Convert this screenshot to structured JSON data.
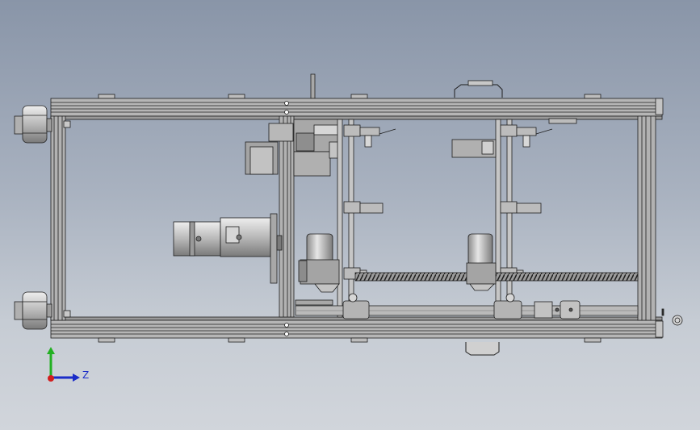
{
  "viewport": {
    "background_top": "#8995a8",
    "background_bottom": "#d1d5db"
  },
  "model": {
    "part_fill": "#b4b4b4",
    "edge_color": "#1e1e1e",
    "shade_fill": "#8c8c8c",
    "highlight_fill": "#dcdcdc"
  },
  "triad": {
    "z_label": "Z",
    "x_axis_color": "#d21e1e",
    "y_axis_color": "#22b022",
    "z_axis_color": "#1a2cc8"
  }
}
